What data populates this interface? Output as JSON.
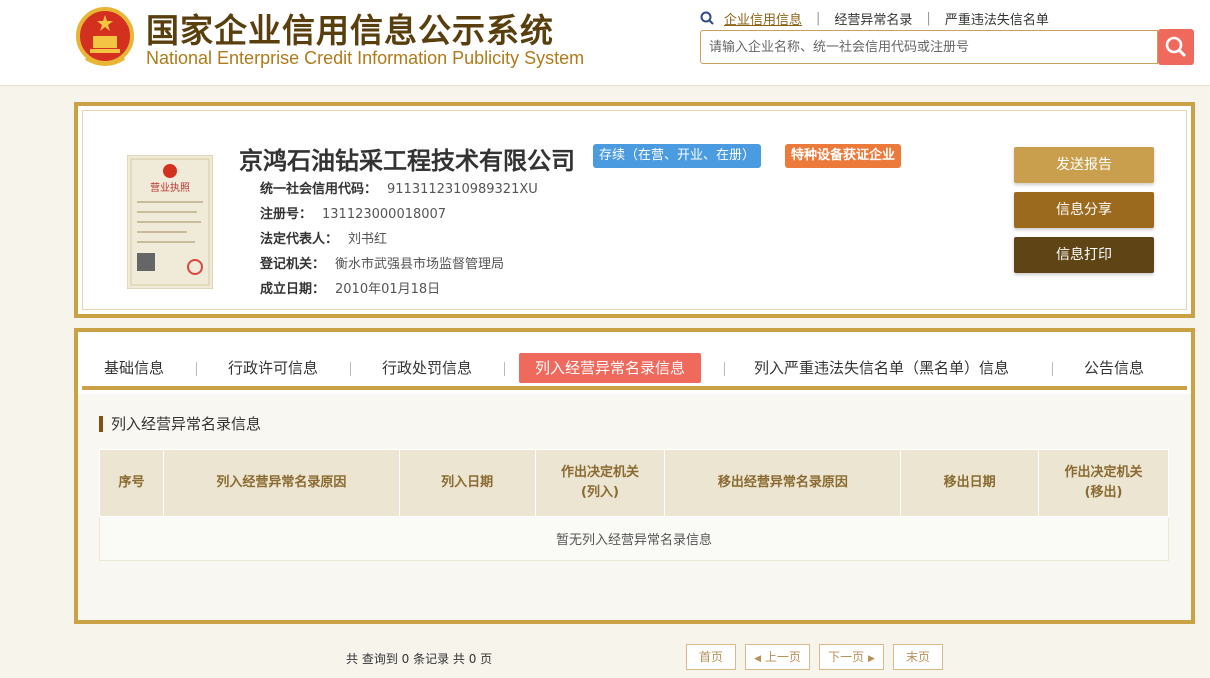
{
  "header": {
    "title": "国家企业信用信息公示系统",
    "subtitle": "National Enterprise Credit Information Publicity System",
    "links": [
      "企业信用信息",
      "经营异常名录",
      "严重违法失信名单"
    ],
    "search_placeholder": "请输入企业名称、统一社会信用代码或注册号"
  },
  "company": {
    "name": "京鸿石油钻采工程技术有限公司",
    "status_badge": "存续（在营、开业、在册）",
    "special_badge": "特种设备获证企业",
    "fields": [
      {
        "label": "统一社会信用代码：",
        "value": "91131123109893​21XU"
      },
      {
        "label": "注册号：",
        "value": "131123000018007"
      },
      {
        "label": "法定代表人：",
        "value": "刘书红"
      },
      {
        "label": "登记机关：",
        "value": "衡水市武强县市场监督管理局"
      },
      {
        "label": "成立日期：",
        "value": "2010年01月18日"
      }
    ],
    "license_title": "营业执照",
    "actions": {
      "send": "发送报告",
      "share": "信息分享",
      "print": "信息打印"
    }
  },
  "tabs": [
    "基础信息",
    "行政许可信息",
    "行政处罚信息",
    "列入经营异常名录信息",
    "列入严重违法失信名单（黑名单）信息",
    "公告信息"
  ],
  "section": {
    "title": "列入经营异常名录信息",
    "columns": [
      "序号",
      "列入经营异常名录原因",
      "列入日期",
      "作出决定机关\n(列入)",
      "移出经营异常名录原因",
      "移出日期",
      "作出决定机关\n(移出)"
    ],
    "empty_text": "暂无列入经营异常名录信息"
  },
  "pager": {
    "summary": "共 查询到 0 条记录 共 0 页",
    "first": "首页",
    "prev": "上一页",
    "next": "下一页",
    "last": "末页"
  },
  "colors": {
    "gold_border": "#caa245",
    "accent_red": "#ef6a5c",
    "status_blue": "#4a9be0",
    "special_orange": "#ec7a3a"
  }
}
